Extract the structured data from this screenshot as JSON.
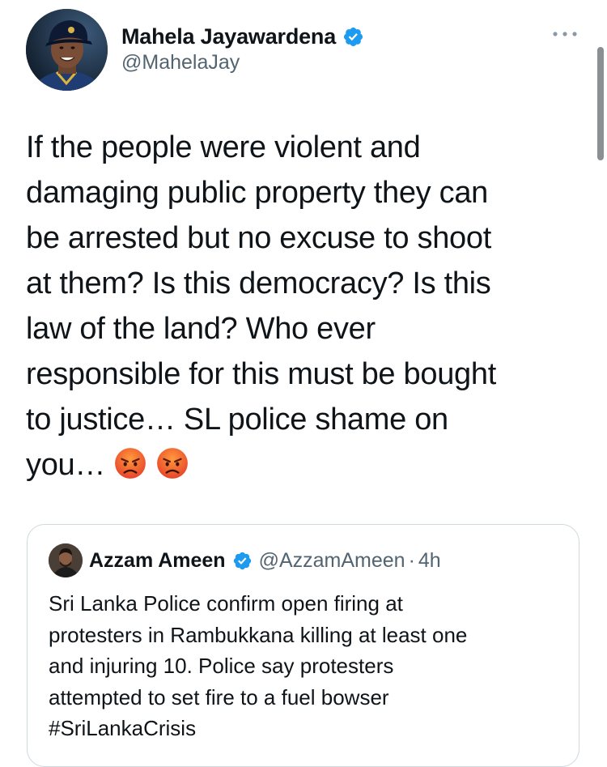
{
  "author": {
    "display_name": "Mahela Jayawardena",
    "handle": "@MahelaJay",
    "verified": true
  },
  "tweet": {
    "text": "If the people were violent and\ndamaging public property they can\nbe arrested but no excuse to shoot\nat them? Is this democracy? Is this\nlaw of the land? Who ever\nresponsible for this must be bought\nto justice… SL police shame on\nyou…",
    "emojis": [
      "angry-face-emoji",
      "angry-face-emoji"
    ]
  },
  "quoted_tweet": {
    "display_name": "Azzam Ameen",
    "handle": "@AzzamAmeen",
    "separator": "·",
    "time": "4h",
    "verified": true,
    "text": "Sri Lanka Police confirm open firing at\nprotesters in Rambukkana killing at least one\nand injuring 10. Police say protesters\nattempted to set fire to a fuel bowser\n#SriLankaCrisis"
  },
  "colors": {
    "verified_blue": "#1d9bf0",
    "secondary_text": "#536471",
    "primary_text": "#0f1419",
    "border": "#cfd9de"
  },
  "icons": {
    "more": "more-horizontal-icon",
    "verified": "verified-badge-icon"
  }
}
